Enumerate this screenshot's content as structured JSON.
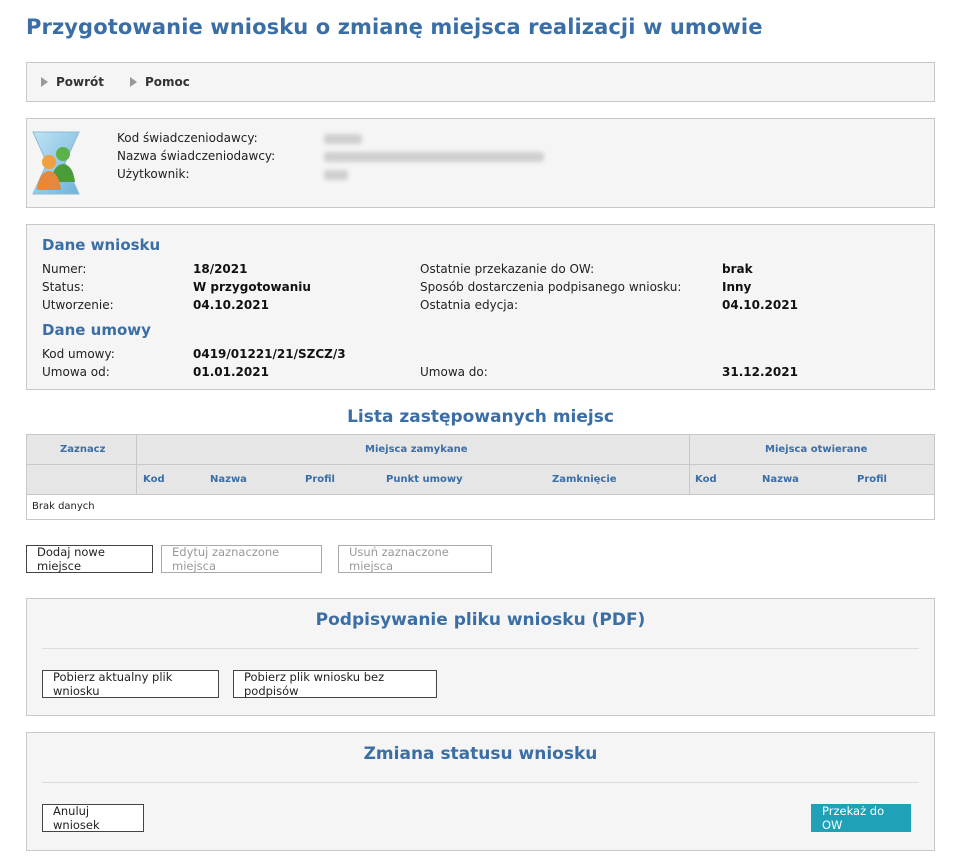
{
  "page": {
    "title": "Przygotowanie wniosku o zmianę miejsca realizacji w umowie"
  },
  "nav": {
    "back": "Powrót",
    "help": "Pomoc"
  },
  "provider": {
    "code_label": "Kod świadczeniodawcy:",
    "name_label": "Nazwa świadczeniodawcy:",
    "user_label": "Użytkownik:"
  },
  "application": {
    "section_title": "Dane wniosku",
    "number_label": "Numer:",
    "number": "18/2021",
    "status_label": "Status:",
    "status": "W przygotowaniu",
    "created_label": "Utworzenie:",
    "created": "04.10.2021",
    "last_transfer_label": "Ostatnie przekazanie do OW:",
    "last_transfer": "brak",
    "delivery_label": "Sposób dostarczenia podpisanego wniosku:",
    "delivery": "Inny",
    "last_edit_label": "Ostatnia edycja:",
    "last_edit": "04.10.2021"
  },
  "contract": {
    "section_title": "Dane umowy",
    "code_label": "Kod umowy:",
    "code": "0419/01221/21/SZCZ/3",
    "from_label": "Umowa od:",
    "from": "01.01.2021",
    "to_label": "Umowa do:",
    "to": "31.12.2021"
  },
  "places": {
    "title": "Lista zastępowanych miejsc",
    "col_select": "Zaznacz",
    "group_closed": "Miejsca zamykane",
    "group_opened": "Miejsca otwierane",
    "closed_cols": [
      "Kod",
      "Nazwa",
      "Profil",
      "Punkt umowy",
      "Zamknięcie"
    ],
    "opened_cols": [
      "Kod",
      "Nazwa",
      "Profil"
    ],
    "empty": "Brak danych"
  },
  "actions": {
    "add": "Dodaj nowe miejsce",
    "edit": "Edytuj zaznaczone miejsca",
    "remove": "Usuń zaznaczone miejsca"
  },
  "signing": {
    "title": "Podpisywanie pliku wniosku (PDF)",
    "download_current": "Pobierz aktualny plik wniosku",
    "download_unsigned": "Pobierz plik wniosku bez podpisów"
  },
  "status_change": {
    "title": "Zmiana statusu wniosku",
    "cancel": "Anuluj wniosek",
    "submit": "Przekaż do OW"
  },
  "colors": {
    "heading": "#3a6ea5",
    "primary_button": "#1fa2b8"
  }
}
